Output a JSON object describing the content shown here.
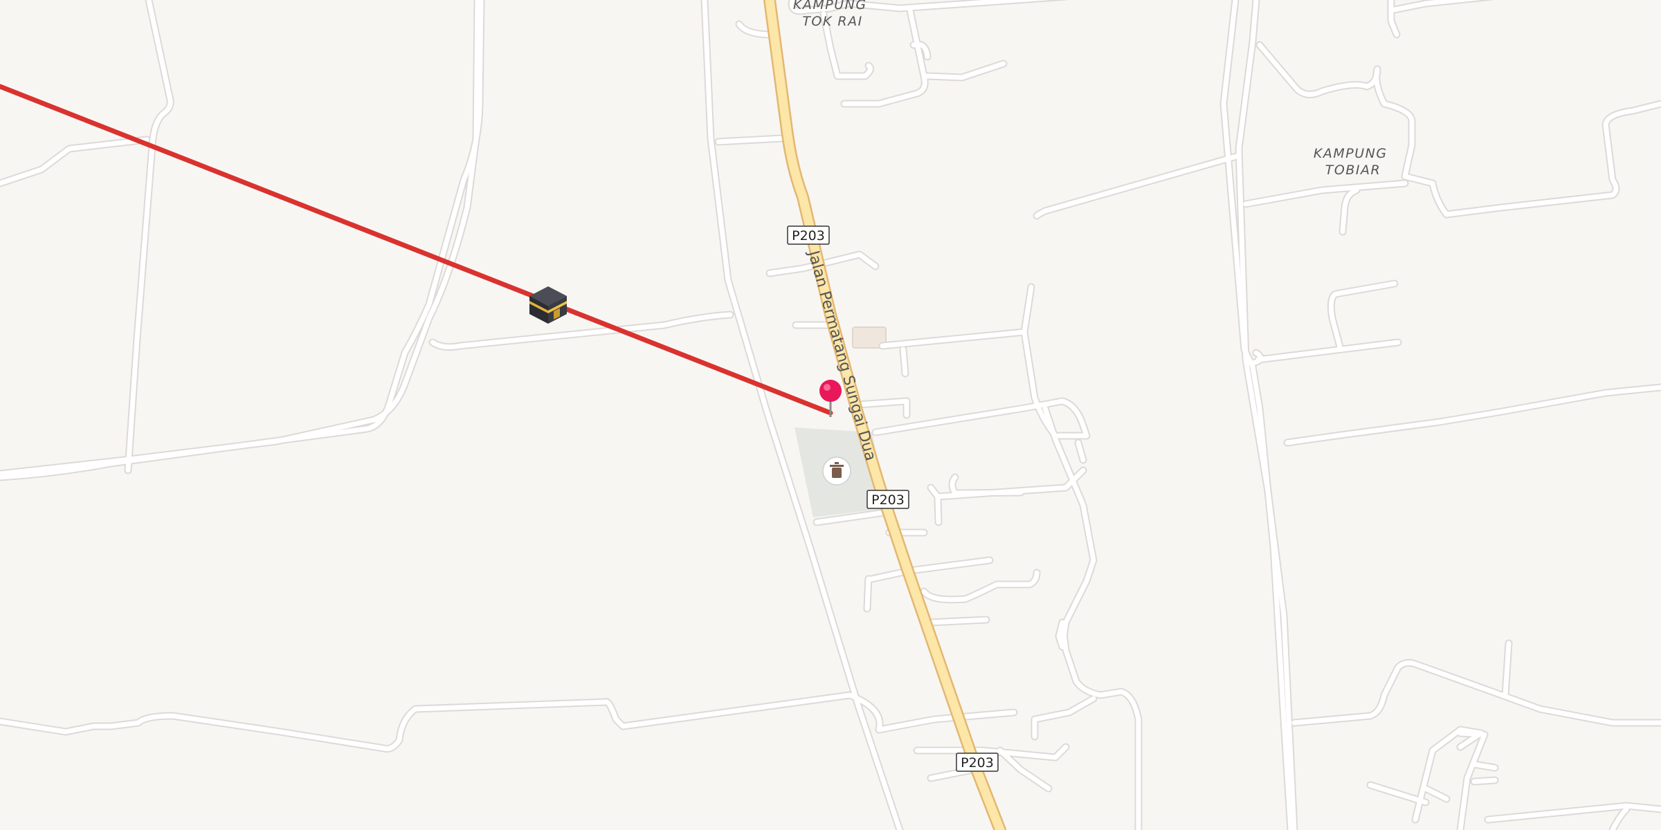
{
  "map": {
    "places": {
      "kampung_tok_rai": [
        "KAMPUNG",
        "TOK RAI"
      ],
      "kampung_tobiar": [
        "KAMPUNG",
        "TOBIAR"
      ]
    },
    "road_name": "Jalan Permatang Sungai Dua",
    "route_shields": [
      "P203",
      "P203",
      "P203"
    ],
    "icons": {
      "kaaba": "kaaba-icon",
      "location_pin": "location-pin-icon",
      "poi": "trash-bin-icon"
    },
    "colors": {
      "background": "#f8f6f3",
      "qibla_line": "#d9322f",
      "main_road": "#fce6a8",
      "main_road_casing": "#e3b770",
      "minor_road": "#ffffff",
      "pin": "#e8185a",
      "green_area": "#e4e6e1"
    }
  }
}
